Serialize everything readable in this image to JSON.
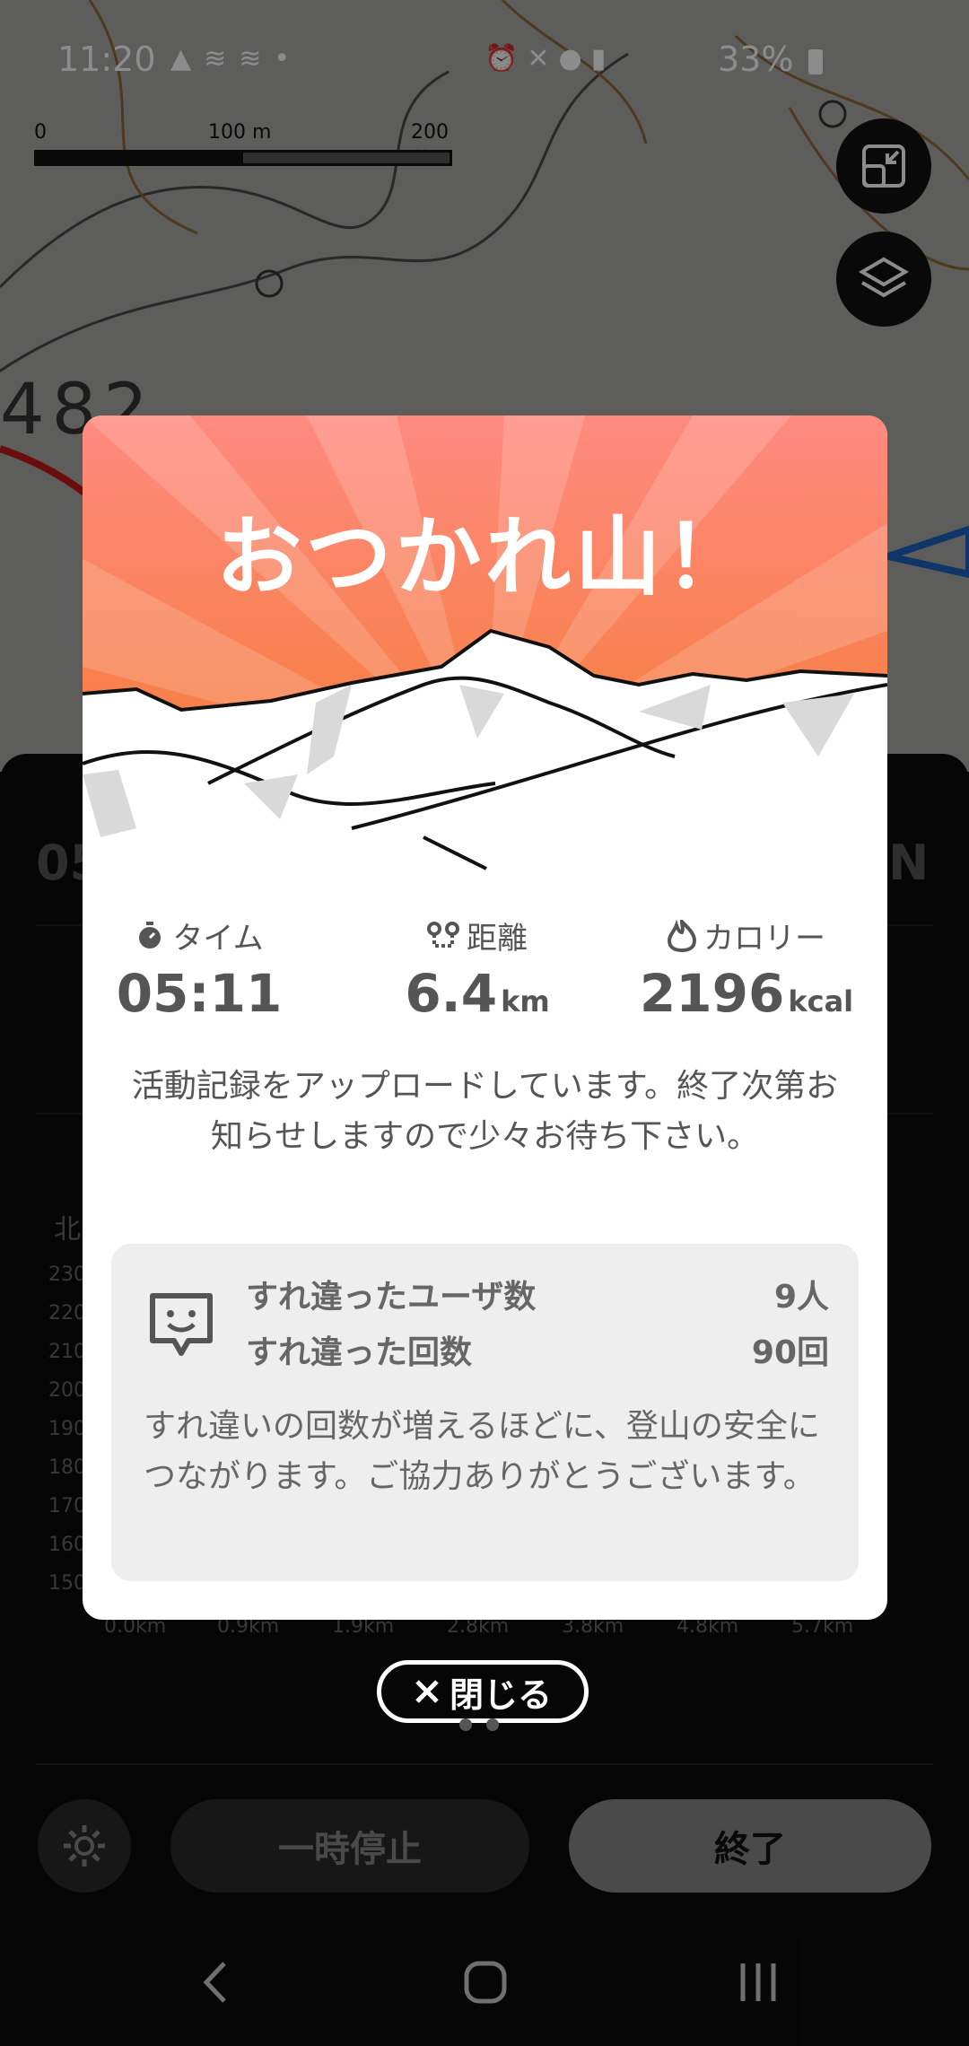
{
  "status": {
    "time": "11:20",
    "battery": "33%"
  },
  "map": {
    "scale_labels": [
      "0",
      "100 m",
      "200 m"
    ],
    "contour_number": "482"
  },
  "background": {
    "stat_partial_left": "05",
    "stat_partial_right": "N",
    "chart_left_label": "北",
    "y_ticks": [
      "230",
      "220",
      "210",
      "200",
      "190",
      "180",
      "170",
      "160",
      "150"
    ],
    "x_ticks": [
      "0.0km",
      "0.9km",
      "1.9km",
      "2.8km",
      "3.8km",
      "4.8km",
      "5.7km"
    ]
  },
  "dialog": {
    "title": "おつかれ山！",
    "stats": [
      {
        "label": "タイム",
        "value": "05:11",
        "unit": ""
      },
      {
        "label": "距離",
        "value": "6.4",
        "unit": "km"
      },
      {
        "label": "カロリー",
        "value": "2196",
        "unit": "kcal"
      }
    ],
    "message": "活動記録をアップロードしています。終了次第お知らせしますので少々お待ち下さい。",
    "passing": {
      "users_label": "すれ違ったユーザ数",
      "users_value": "9人",
      "count_label": "すれ違った回数",
      "count_value": "90回",
      "note": "すれ違いの回数が増えるほどに、登山の安全につながります。ご協力ありがとうございます。"
    }
  },
  "close_label": "閉じる",
  "controls": {
    "pause_label": "一時停止",
    "end_label": "終了"
  },
  "icons": [
    "navigation-icon",
    "signal-icon",
    "alarm-icon",
    "mute-icon",
    "location-icon",
    "battery-icon",
    "expand-icon",
    "layers-icon",
    "timer-icon",
    "route-icon",
    "flame-icon",
    "chat-face-icon",
    "close-icon",
    "gear-icon",
    "back-icon",
    "home-icon",
    "recents-icon"
  ],
  "colors": {
    "banner_top": "#ff8a80",
    "banner_bottom": "#f27a2a",
    "dialog_text": "#555555",
    "end_button": "#888888"
  }
}
